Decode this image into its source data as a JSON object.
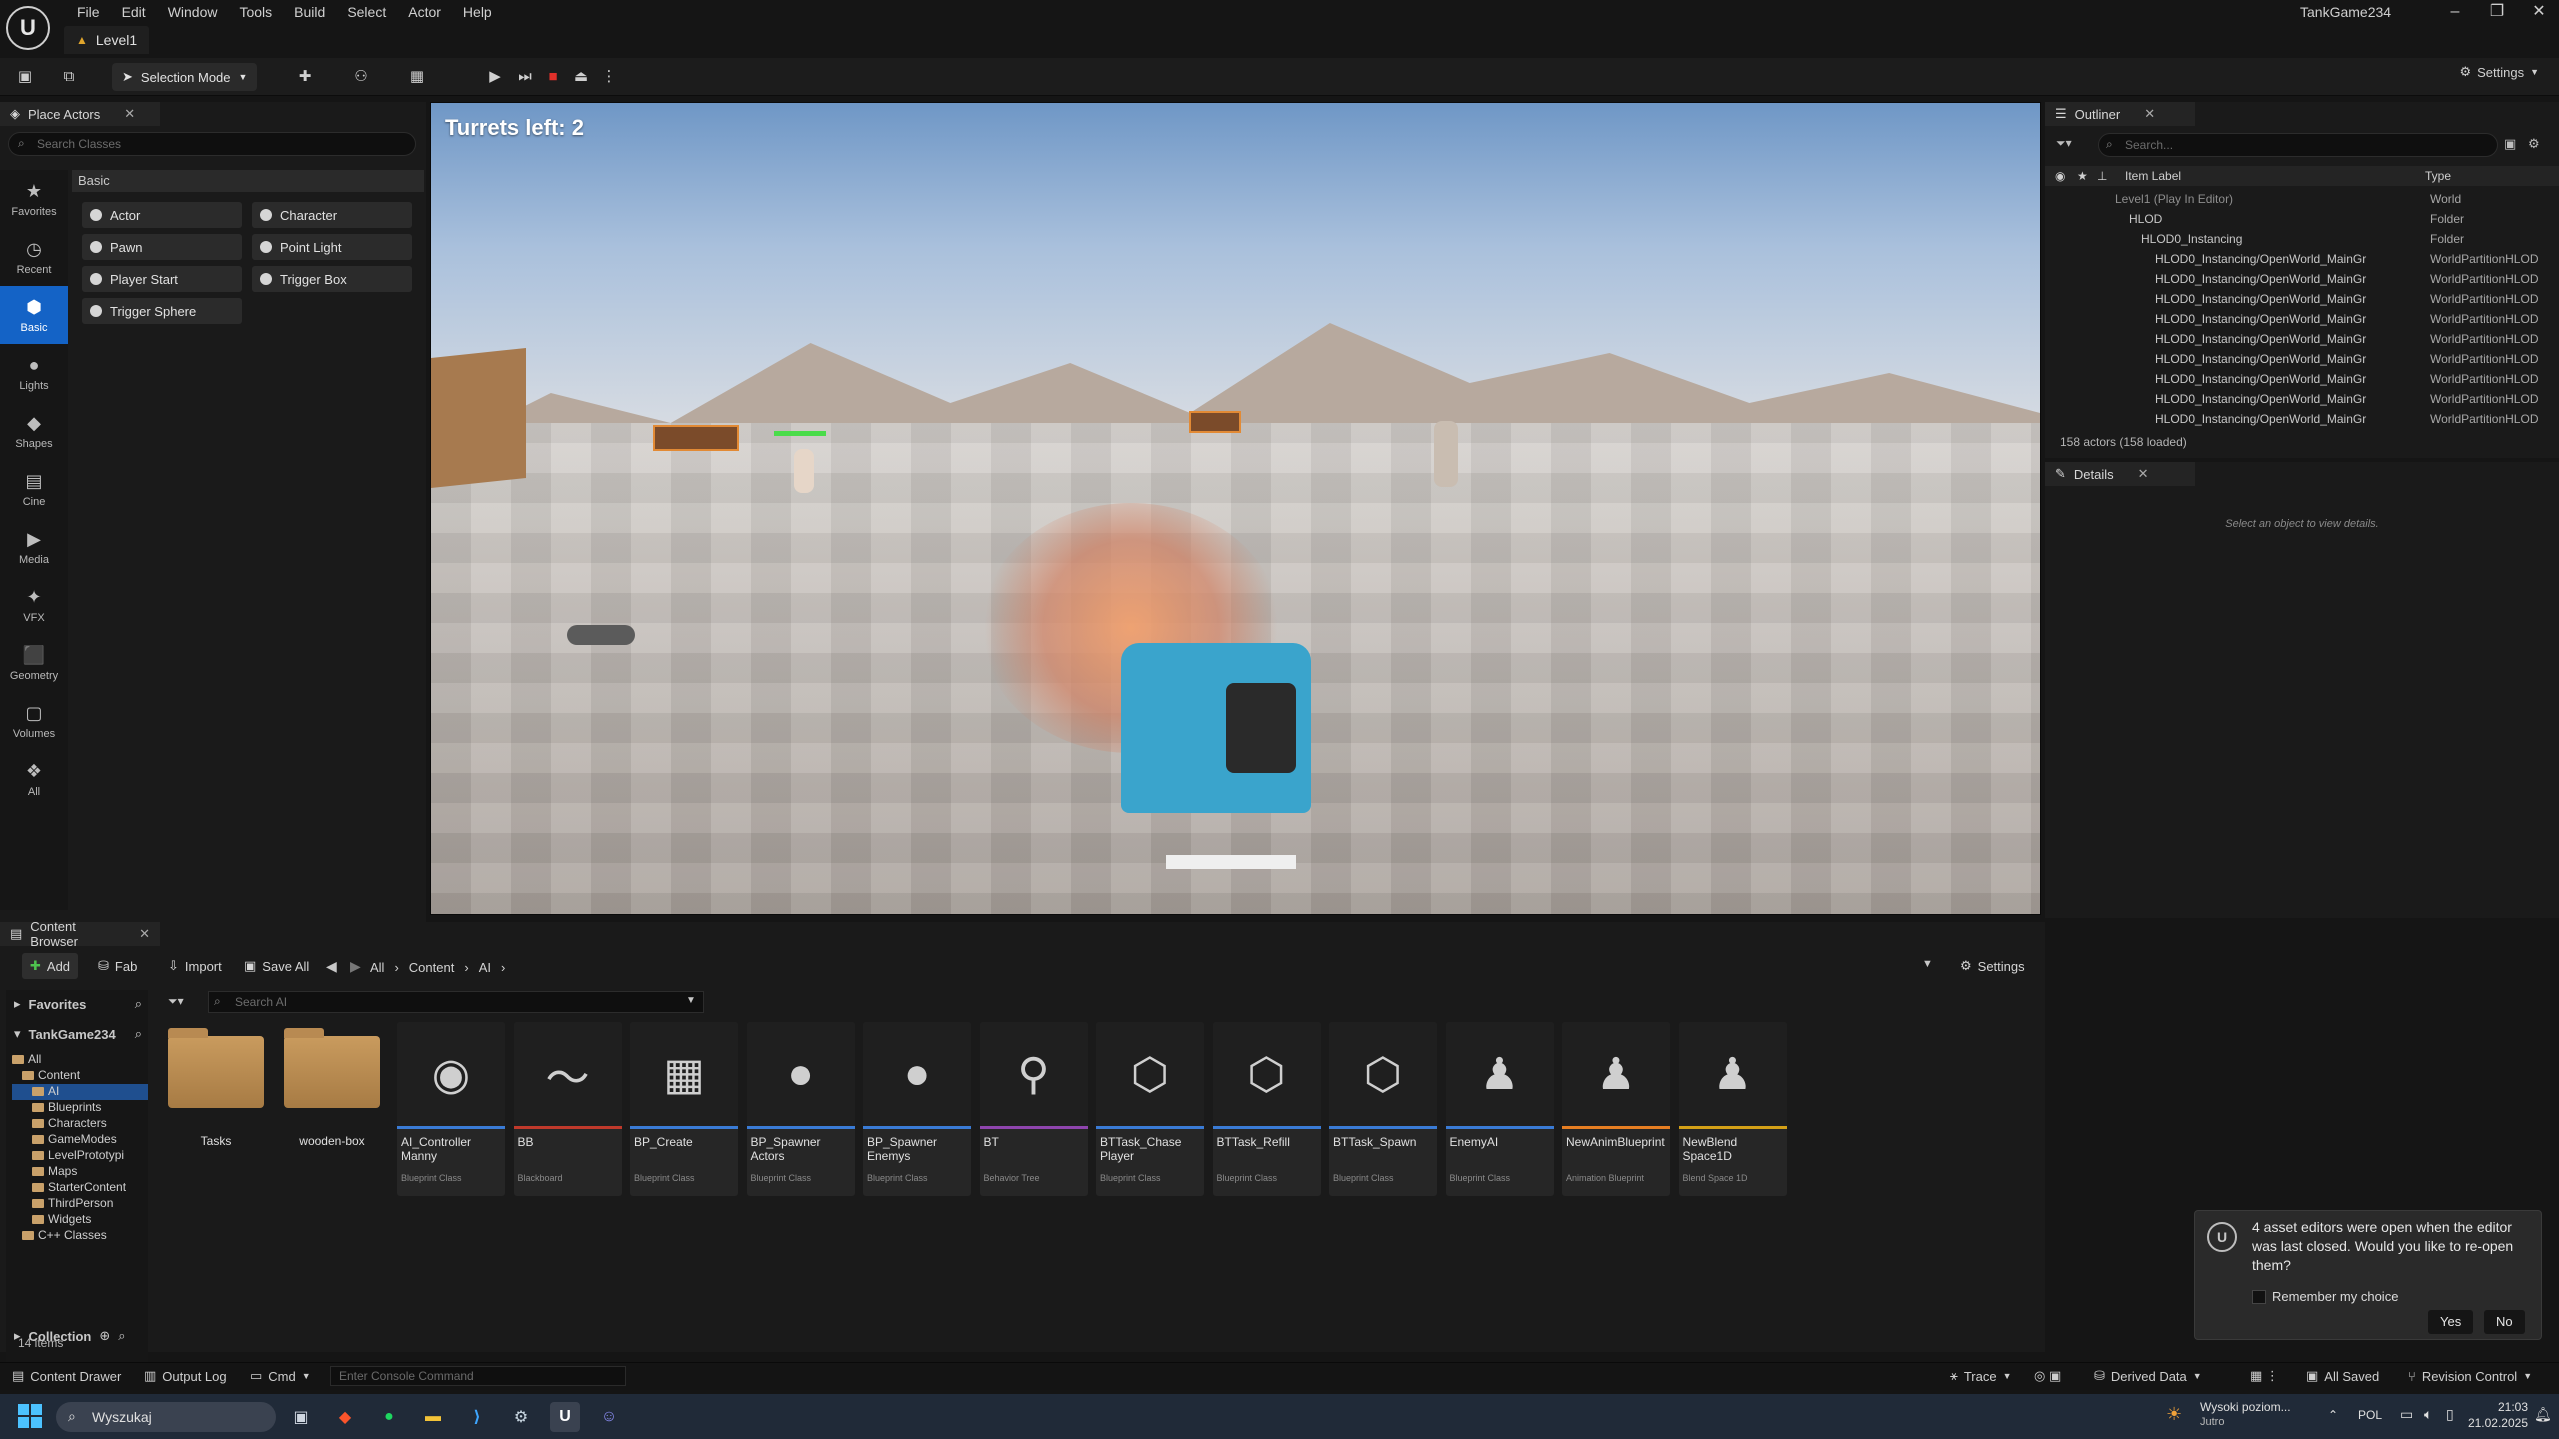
{
  "menu": [
    "File",
    "Edit",
    "Window",
    "Tools",
    "Build",
    "Select",
    "Actor",
    "Help"
  ],
  "level_tab": "Level1",
  "project_name": "TankGame234",
  "toolbar": {
    "selection_mode": "Selection Mode",
    "settings": "Settings"
  },
  "place_actors": {
    "tab": "Place Actors",
    "search_placeholder": "Search Classes",
    "section": "Basic",
    "categories": [
      "Favorites",
      "Recent",
      "Basic",
      "Lights",
      "Shapes",
      "Cine",
      "Media",
      "VFX",
      "Geometry",
      "Volumes",
      "All"
    ],
    "actors": [
      "Actor",
      "Character",
      "Pawn",
      "Point Light",
      "Player Start",
      "Trigger Box",
      "Trigger Sphere"
    ]
  },
  "viewport": {
    "hud": "Turrets left: 2"
  },
  "outliner": {
    "tab": "Outliner",
    "search_placeholder": "Search...",
    "col_label": "Item Label",
    "col_type": "Type",
    "rows": [
      {
        "label": "Level1 (Play In Editor)",
        "type": "World"
      },
      {
        "label": "HLOD",
        "type": "Folder"
      },
      {
        "label": "HLOD0_Instancing",
        "type": "Folder"
      },
      {
        "label": "HLOD0_Instancing/OpenWorld_MainGr",
        "type": "WorldPartitionHLOD"
      },
      {
        "label": "HLOD0_Instancing/OpenWorld_MainGr",
        "type": "WorldPartitionHLOD"
      },
      {
        "label": "HLOD0_Instancing/OpenWorld_MainGr",
        "type": "WorldPartitionHLOD"
      },
      {
        "label": "HLOD0_Instancing/OpenWorld_MainGr",
        "type": "WorldPartitionHLOD"
      },
      {
        "label": "HLOD0_Instancing/OpenWorld_MainGr",
        "type": "WorldPartitionHLOD"
      },
      {
        "label": "HLOD0_Instancing/OpenWorld_MainGr",
        "type": "WorldPartitionHLOD"
      },
      {
        "label": "HLOD0_Instancing/OpenWorld_MainGr",
        "type": "WorldPartitionHLOD"
      },
      {
        "label": "HLOD0_Instancing/OpenWorld_MainGr",
        "type": "WorldPartitionHLOD"
      },
      {
        "label": "HLOD0_Instancing/OpenWorld_MainGr",
        "type": "WorldPartitionHLOD"
      }
    ],
    "count": "158 actors (158 loaded)"
  },
  "details": {
    "tab": "Details",
    "message": "Select an object to view details."
  },
  "content_browser": {
    "tab": "Content Browser",
    "add": "Add",
    "fab": "Fab",
    "import": "Import",
    "save_all": "Save All",
    "settings": "Settings",
    "path": [
      "All",
      "Content",
      "AI"
    ],
    "favorites": "Favorites",
    "project": "TankGame234",
    "collection": "Collection",
    "search_placeholder": "Search AI",
    "tree": [
      "All",
      "Content",
      "AI",
      "Blueprints",
      "Characters",
      "GameModes",
      "LevelPrototypi",
      "Maps",
      "StarterContent",
      "ThirdPerson",
      "Widgets",
      "C++ Classes"
    ],
    "folders": [
      "Tasks",
      "wooden-box"
    ],
    "assets": [
      {
        "name": "AI_Controller Manny",
        "cls": "Blueprint Class",
        "color": "#3a7bd5"
      },
      {
        "name": "BB",
        "cls": "Blackboard",
        "color": "#c0392b"
      },
      {
        "name": "BP_Create",
        "cls": "Blueprint Class",
        "color": "#3a7bd5"
      },
      {
        "name": "BP_Spawner Actors",
        "cls": "Blueprint Class",
        "color": "#3a7bd5"
      },
      {
        "name": "BP_Spawner Enemys",
        "cls": "Blueprint Class",
        "color": "#3a7bd5"
      },
      {
        "name": "BT",
        "cls": "Behavior Tree",
        "color": "#8e44ad"
      },
      {
        "name": "BTTask_Chase Player",
        "cls": "Blueprint Class",
        "color": "#3a7bd5"
      },
      {
        "name": "BTTask_Refill",
        "cls": "Blueprint Class",
        "color": "#3a7bd5"
      },
      {
        "name": "BTTask_Spawn",
        "cls": "Blueprint Class",
        "color": "#3a7bd5"
      },
      {
        "name": "EnemyAI",
        "cls": "Blueprint Class",
        "color": "#3a7bd5"
      },
      {
        "name": "NewAnimBlueprint",
        "cls": "Animation Blueprint",
        "color": "#e67e22"
      },
      {
        "name": "NewBlend Space1D",
        "cls": "Blend Space 1D",
        "color": "#d4a017"
      }
    ],
    "count": "14 items"
  },
  "notification": {
    "text": "4 asset editors were open when the editor was last closed. Would you like to re-open them?",
    "remember": "Remember my choice",
    "yes": "Yes",
    "no": "No"
  },
  "statusbar": {
    "content_drawer": "Content Drawer",
    "output_log": "Output Log",
    "cmd": "Cmd",
    "console_placeholder": "Enter Console Command",
    "trace": "Trace",
    "derived_data": "Derived Data",
    "all_saved": "All Saved",
    "revision_control": "Revision Control"
  },
  "taskbar": {
    "search": "Wyszukaj",
    "weather_title": "Wysoki poziom...",
    "weather_sub": "Jutro",
    "lang": "POL",
    "time": "21:03",
    "date": "21.02.2025"
  }
}
